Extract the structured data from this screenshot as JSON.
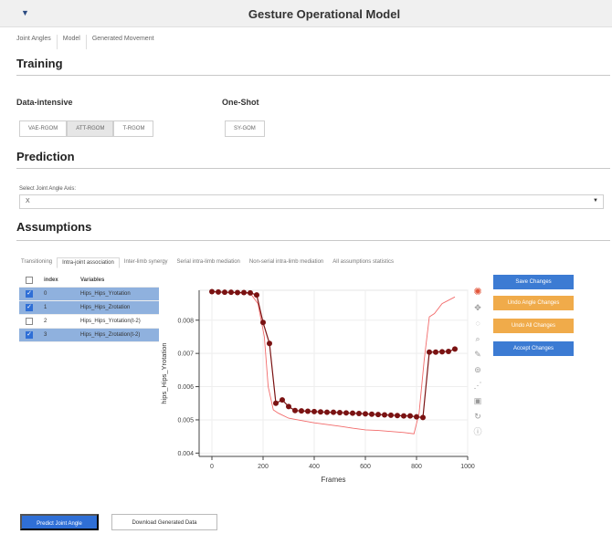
{
  "app": {
    "title": "Gesture Operational Model",
    "tabs": [
      "Joint Angles",
      "Model",
      "Generated Movement"
    ]
  },
  "training": {
    "title": "Training",
    "data_intensive": {
      "title": "Data-intensive",
      "buttons": [
        "VAE-RGOM",
        "ATT-RGOM",
        "T-RGOM"
      ],
      "active_index": 1
    },
    "one_shot": {
      "title": "One-Shot",
      "buttons": [
        "SY-GOM"
      ]
    }
  },
  "prediction": {
    "title": "Prediction",
    "select_label": "Select Joint Angle Axis:",
    "select_value": "X"
  },
  "assumptions": {
    "title": "Assumptions",
    "tabs": [
      "Transitioning",
      "Intra-joint association",
      "Inter-limb synergy",
      "Serial intra-limb mediation",
      "Non-serial intra-limb mediation",
      "All assumptions statistics"
    ],
    "active_tab": 1,
    "table": {
      "columns": [
        "index",
        "Variables"
      ],
      "rows": [
        {
          "index": "0",
          "variable": "Hips_Hips_Yrotation",
          "checked": true
        },
        {
          "index": "1",
          "variable": "Hips_Hips_Zrotation",
          "checked": true
        },
        {
          "index": "2",
          "variable": "Hips_Hips_Yrotation(t-2)",
          "checked": false
        },
        {
          "index": "3",
          "variable": "Hips_Hips_Zrotation(t-2)",
          "checked": true
        }
      ]
    },
    "actions": {
      "save": "Save Changes",
      "undo_angle": "Undo Angle Changes",
      "undo_all": "Undo All Changes",
      "accept": "Accept Changes"
    },
    "toolbar_icons": [
      "bokeh-logo-icon",
      "pan-icon",
      "lasso-select-icon",
      "zoom-icon",
      "box-edit-icon",
      "wheel-zoom-icon",
      "crosshair-icon",
      "save-icon",
      "reset-icon",
      "help-icon"
    ]
  },
  "chart_data": {
    "type": "line",
    "xlabel": "Frames",
    "ylabel": "hips_Hips_Yrotation",
    "xlim": [
      -50,
      1000
    ],
    "ylim": [
      0.0039,
      0.0089
    ],
    "xticks": [
      0,
      200,
      400,
      600,
      800,
      1000
    ],
    "yticks": [
      0.004,
      0.005,
      0.006,
      0.007,
      0.008
    ],
    "series": [
      {
        "style": "line-with-markers",
        "color": "#7a1212",
        "x": [
          0,
          25,
          50,
          75,
          100,
          125,
          150,
          175,
          200,
          225,
          250,
          275,
          300,
          325,
          350,
          375,
          400,
          425,
          450,
          475,
          500,
          525,
          550,
          575,
          600,
          625,
          650,
          675,
          700,
          725,
          750,
          775,
          800,
          825,
          850,
          875,
          900,
          925,
          950
        ],
        "y": [
          0.00886,
          0.00885,
          0.00884,
          0.00884,
          0.00883,
          0.00883,
          0.00882,
          0.00876,
          0.00793,
          0.0073,
          0.0055,
          0.0056,
          0.0054,
          0.00528,
          0.00527,
          0.00526,
          0.00525,
          0.00524,
          0.00523,
          0.00523,
          0.00522,
          0.00521,
          0.0052,
          0.00519,
          0.00518,
          0.00517,
          0.00516,
          0.00515,
          0.00514,
          0.00513,
          0.00512,
          0.00512,
          0.00509,
          0.00507,
          0.00704,
          0.00704,
          0.00705,
          0.00706,
          0.00713
        ]
      },
      {
        "style": "line",
        "color": "#f26a6a",
        "x": [
          0,
          50,
          100,
          150,
          180,
          205,
          220,
          240,
          260,
          300,
          350,
          400,
          450,
          500,
          550,
          600,
          650,
          700,
          750,
          790,
          810,
          830,
          850,
          870,
          900,
          950
        ],
        "y": [
          0.00885,
          0.00884,
          0.00882,
          0.00881,
          0.0085,
          0.0075,
          0.006,
          0.0053,
          0.0052,
          0.00505,
          0.00498,
          0.00491,
          0.00486,
          0.00481,
          0.00475,
          0.0047,
          0.00468,
          0.00465,
          0.00462,
          0.00458,
          0.0052,
          0.0068,
          0.0081,
          0.0082,
          0.0085,
          0.0087
        ]
      }
    ]
  },
  "bottom": {
    "predict": "Predict Joint Angle",
    "download": "Download Generated Data"
  }
}
